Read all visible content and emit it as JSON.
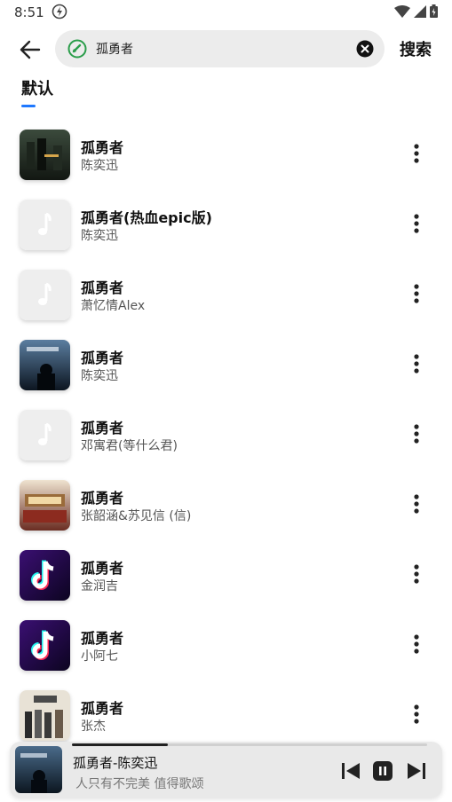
{
  "status": {
    "time": "8:51"
  },
  "search": {
    "query": "孤勇者",
    "button_label": "搜索"
  },
  "tabs": [
    {
      "label": "默认",
      "active": true
    }
  ],
  "accent_color": "#1e78ff",
  "results": [
    {
      "title": "孤勇者",
      "artist": "陈奕迅",
      "cover": "dark-movie-poster"
    },
    {
      "title": "孤勇者(热血epic版)",
      "artist": "陈奕迅",
      "cover": "placeholder-note"
    },
    {
      "title": "孤勇者",
      "artist": "萧忆情Alex",
      "cover": "placeholder-note"
    },
    {
      "title": "孤勇者",
      "artist": "陈奕迅",
      "cover": "night-city"
    },
    {
      "title": "孤勇者",
      "artist": "邓寓君(等什么君)",
      "cover": "placeholder-note"
    },
    {
      "title": "孤勇者",
      "artist": "张韶涵&苏见信 (信)",
      "cover": "stage-show"
    },
    {
      "title": "孤勇者",
      "artist": "金润吉",
      "cover": "tiktok-logo"
    },
    {
      "title": "孤勇者",
      "artist": "小阿七",
      "cover": "tiktok-logo"
    },
    {
      "title": "孤勇者",
      "artist": "张杰",
      "cover": "group-photo"
    }
  ],
  "player": {
    "title": "孤勇者-陈奕迅",
    "subtitle": "人只有不完美 值得歌颂",
    "progress": 0.27
  }
}
